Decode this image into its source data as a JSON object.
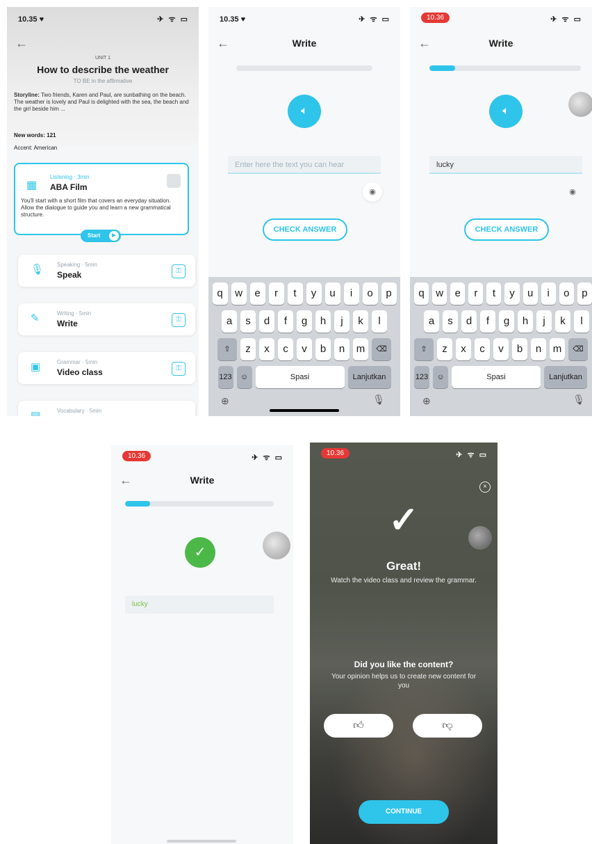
{
  "screen1": {
    "time": "10.35 ♥",
    "status_icons": "✈ ᯤ ▭",
    "unit": "UNIT 1",
    "title": "How to describe the weather",
    "subtitle": "TO BE in the affirmative",
    "storyline_label": "Storyline:",
    "storyline_text": "Two friends, Karen and Paul, are sunbathing on the beach. The weather is lovely and Paul is delighted with the sea, the beach and the girl beside him ...",
    "new_words": "New words: 121",
    "accent": "Accent: American",
    "film_card": {
      "small": "Listening · 3min",
      "title": "ABA Film",
      "desc": "You'll start with a short film that covers an everyday situation. Allow the dialogue to guide you and learn a new grammatical structure.",
      "start": "Start"
    },
    "lessons": [
      {
        "small": "Speaking · 5min",
        "title": "Speak",
        "icon": "microphone-icon"
      },
      {
        "small": "Writing · 5min",
        "title": "Write",
        "icon": "pen-icon"
      },
      {
        "small": "Grammar · 5min",
        "title": "Video class",
        "icon": "video-icon"
      },
      {
        "small": "Vocabulary · 5min",
        "title": "",
        "icon": "book-icon"
      }
    ]
  },
  "screen2": {
    "time": "10.35 ♥",
    "status_icons": "✈ ᯤ ▭",
    "title": "Write",
    "input_placeholder": "Enter here the text you can hear",
    "input_value": "",
    "check_label": "CHECK ANSWER",
    "progress": 0
  },
  "screen3": {
    "time": "10.36",
    "status_icons": "✈ ᯤ ▭",
    "title": "Write",
    "input_value": "lucky",
    "check_label": "CHECK ANSWER",
    "progress": 0.17
  },
  "keyboard": {
    "row1": [
      "q",
      "w",
      "e",
      "r",
      "t",
      "y",
      "u",
      "i",
      "o",
      "p"
    ],
    "row2": [
      "a",
      "s",
      "d",
      "f",
      "g",
      "h",
      "j",
      "k",
      "l"
    ],
    "row3": [
      "z",
      "x",
      "c",
      "v",
      "b",
      "n",
      "m"
    ],
    "num": "123",
    "space": "Spasi",
    "next": "Lanjutkan"
  },
  "screen4": {
    "time": "10.36",
    "status_icons": "✈ ᯤ ▭",
    "title": "Write",
    "answer": "lucky",
    "progress": 0.17
  },
  "screen5": {
    "time": "10.36",
    "status_icons": "✈ ᯤ ▭",
    "great": "Great!",
    "great_sub": "Watch the video class and review the grammar.",
    "question": "Did you like the content?",
    "question_sub": "Your opinion helps us to create new content for you",
    "continue_label": "CONTINUE"
  }
}
